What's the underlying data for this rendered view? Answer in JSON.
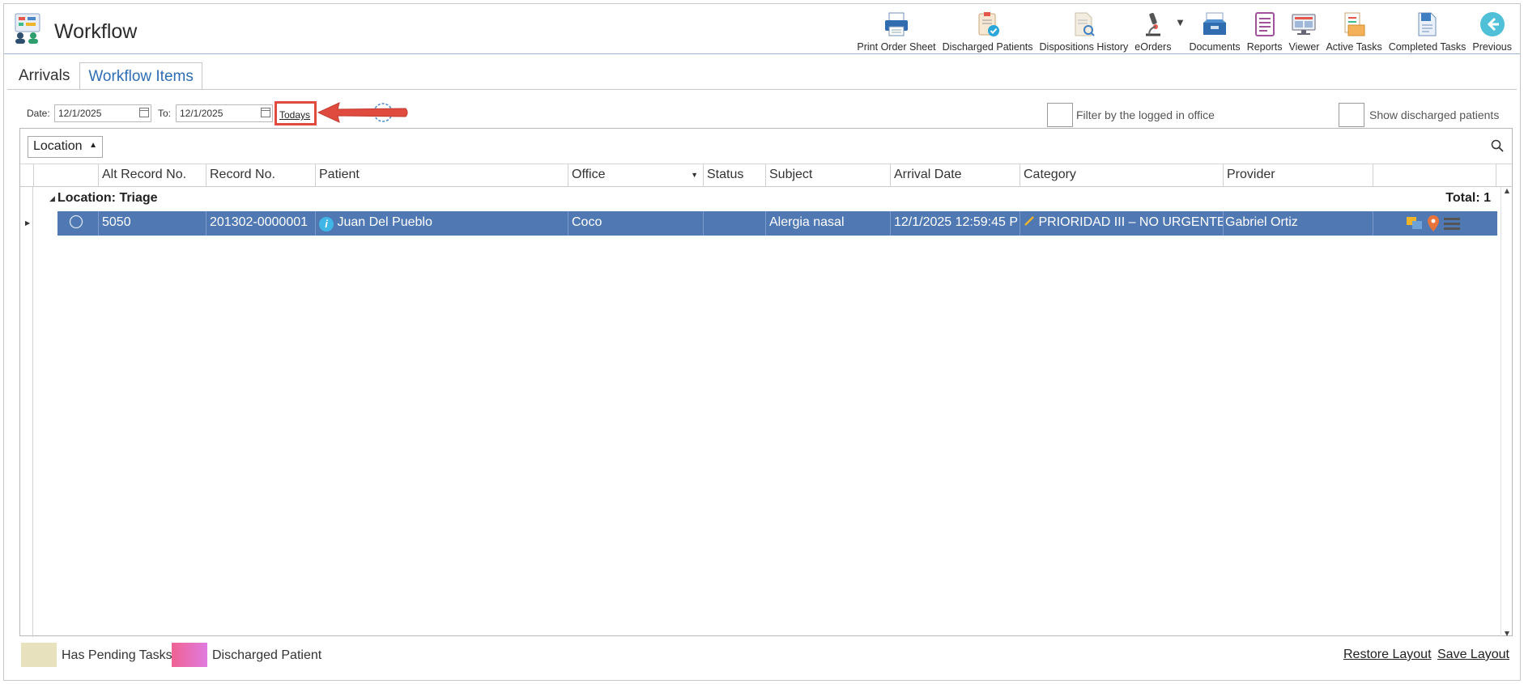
{
  "app": {
    "title": "Workflow",
    "logo_icon": "workflow-app-icon"
  },
  "toolbar": [
    {
      "label": "Print Order Sheet",
      "icon": "printer-icon"
    },
    {
      "label": "Discharged Patients",
      "icon": "clipboard-check-icon"
    },
    {
      "label": "Dispositions History",
      "icon": "document-search-icon"
    },
    {
      "label": "eOrders",
      "icon": "microscope-icon"
    },
    {
      "label": "Documents",
      "icon": "inbox-tray-icon"
    },
    {
      "label": "Reports",
      "icon": "report-list-icon"
    },
    {
      "label": "Viewer",
      "icon": "monitor-icon"
    },
    {
      "label": "Active Tasks",
      "icon": "task-box-icon"
    },
    {
      "label": "Completed Tasks",
      "icon": "completed-doc-icon"
    },
    {
      "label": "Previous",
      "icon": "back-arrow-icon"
    }
  ],
  "tabs": {
    "arrivals": "Arrivals",
    "workflow_items": "Workflow Items"
  },
  "filters": {
    "date_label": "Date:",
    "date_from": "12/1/2025",
    "to_label": "To:",
    "date_to": "12/1/2025",
    "todays_label": "Todays",
    "filter_office_label": "Filter by the logged in office",
    "show_discharged_label": "Show discharged patients"
  },
  "grid": {
    "group_by": "Location",
    "columns": [
      "Alt Record No.",
      "Record No.",
      "Patient",
      "Office",
      "Status",
      "Subject",
      "Arrival Date",
      "Category",
      "Provider"
    ],
    "group_label": "Location: Triage",
    "group_total": "Total: 1",
    "rows": [
      {
        "alt_record": "5050",
        "record": "201302-0000001",
        "patient": "Juan Del Pueblo",
        "office": "Coco",
        "status": "",
        "subject": "Alergia nasal",
        "arrival_date": "12/1/2025 12:59:45 P",
        "category": "PRIORIDAD III – NO URGENTE",
        "provider": "Gabriel Ortiz"
      }
    ]
  },
  "legend": {
    "pending_label": "Has Pending Tasks",
    "pending_color": "#e8e1bd",
    "discharged_label": "Discharged Patient",
    "discharged_color_start": "#f06292",
    "discharged_color_end": "#e07be0"
  },
  "footer": {
    "restore_label": "Restore Layout",
    "save_label": "Save Layout"
  },
  "colors": {
    "accent": "#5078b3",
    "highlight_border": "#e04b3f",
    "tab_blue": "#2e6db4"
  }
}
